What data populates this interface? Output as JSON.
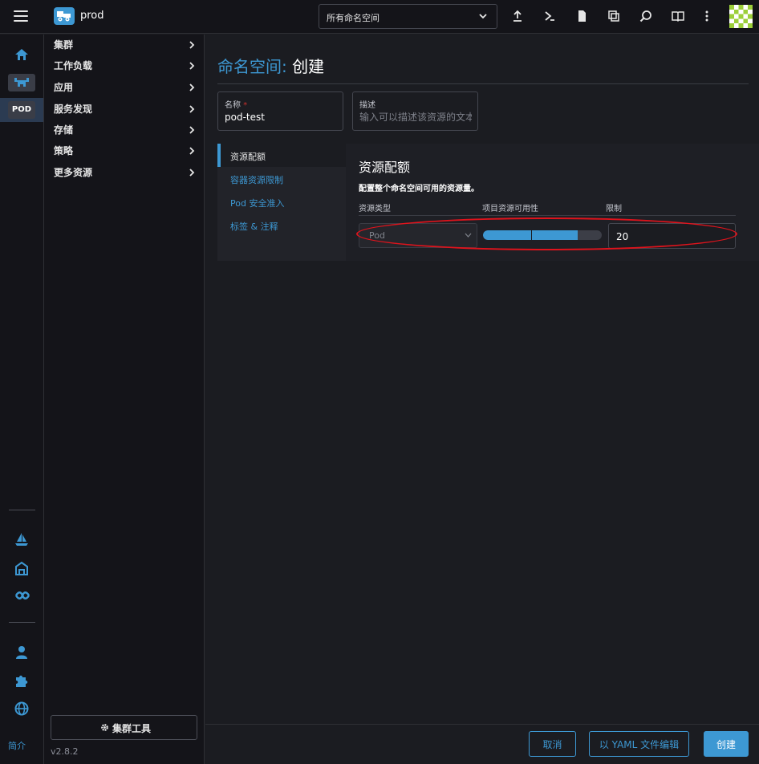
{
  "header": {
    "cluster_name": "prod",
    "namespace_select": "所有命名空间"
  },
  "rail": {
    "pod_badge": "POD",
    "intro_label": "简介"
  },
  "sidebar": {
    "items": [
      {
        "label": "集群"
      },
      {
        "label": "工作负载"
      },
      {
        "label": "应用"
      },
      {
        "label": "服务发现"
      },
      {
        "label": "存储"
      },
      {
        "label": "策略"
      },
      {
        "label": "更多资源"
      }
    ],
    "tools_button": "集群工具",
    "version": "v2.8.2"
  },
  "page": {
    "title_prefix": "命名空间:",
    "title_action": "创建"
  },
  "form": {
    "name_label": "名称",
    "name_required_mark": "*",
    "name_value": "pod-test",
    "desc_label": "描述",
    "desc_placeholder": "输入可以描述该资源的文本"
  },
  "tabs": [
    {
      "label": "资源配额",
      "active": true
    },
    {
      "label": "容器资源限制",
      "active": false
    },
    {
      "label": "Pod 安全准入",
      "active": false
    },
    {
      "label": "标签 & 注释",
      "active": false
    }
  ],
  "quota": {
    "section_title": "资源配额",
    "description": "配置整个命名空间可用的资源量。",
    "columns": [
      "资源类型",
      "项目资源可用性",
      "限制"
    ],
    "row": {
      "resource_type": "Pod",
      "availability_fraction": 0.8,
      "limit": "20"
    }
  },
  "footer": {
    "cancel": "取消",
    "yaml": "以 YAML 文件编辑",
    "create": "创建"
  },
  "colors": {
    "accent": "#3d98d3",
    "background": "#1b1c21",
    "annotation_red": "#e0131c"
  }
}
